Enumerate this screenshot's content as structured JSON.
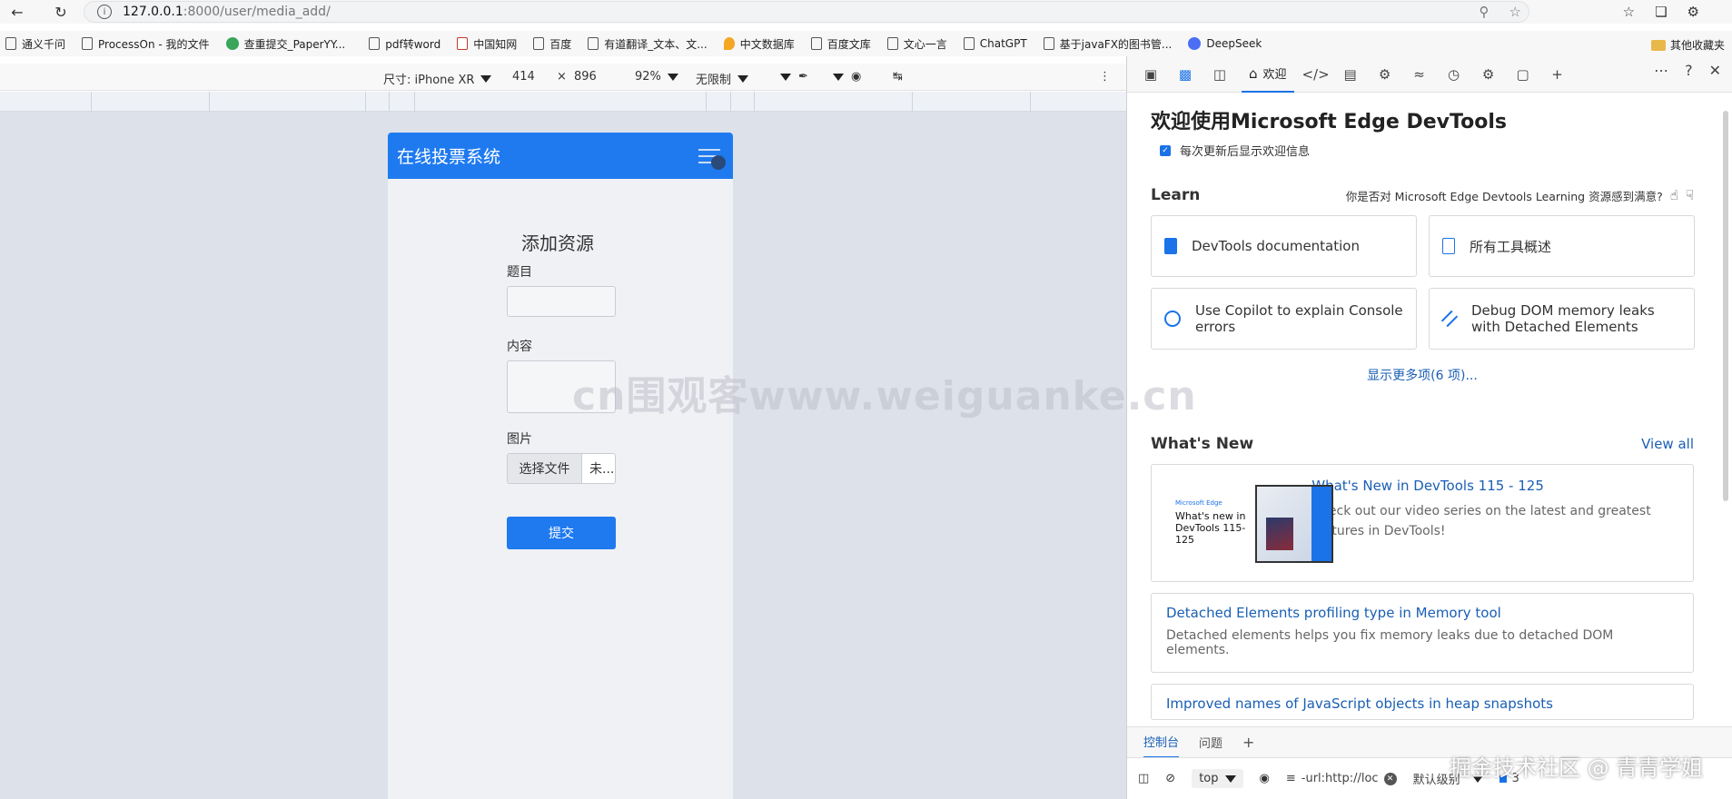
{
  "browser": {
    "url_host": "127.0.0.1",
    "url_path": ":8000/user/media_add/",
    "bookmarks": [
      "通义千问",
      "ProcessOn - 我的文件",
      "查重提交_PaperYY...",
      "pdf转word",
      "中国知网",
      "百度",
      "有道翻译_文本、文...",
      "中文数据库",
      "百度文库",
      "文心一言",
      "ChatGPT",
      "基于javaFX的图书管...",
      "DeepSeek"
    ],
    "bookmarks_folder": "其他收藏夹"
  },
  "device_toolbar": {
    "size_label": "尺寸: iPhone XR",
    "width": "414",
    "times": "×",
    "height": "896",
    "zoom": "92%",
    "throttle": "无限制"
  },
  "app": {
    "title": "在线投票系统",
    "form_title": "添加资源",
    "title_label": "题目",
    "content_label": "内容",
    "image_label": "图片",
    "file_button": "选择文件",
    "file_name": "未...",
    "submit_label": "提交"
  },
  "devtools": {
    "welcome_tab": "欢迎",
    "heading": "欢迎使用Microsoft Edge DevTools",
    "checkbox_label": "每次更新后显示欢迎信息",
    "learn_title": "Learn",
    "learn_question": "你是否对 Microsoft Edge Devtools Learning 资源感到满意?",
    "cards": [
      {
        "label": "DevTools documentation",
        "icon": "book-icon"
      },
      {
        "label": "所有工具概述",
        "icon": "document-icon"
      },
      {
        "label": "Use Copilot to explain Console errors",
        "icon": "copilot-icon"
      },
      {
        "label": "Debug DOM memory leaks with Detached Elements",
        "icon": "link-icon"
      }
    ],
    "show_more": "显示更多项(6 项)...",
    "whats_new_title": "What's New",
    "view_all": "View all",
    "news": [
      {
        "title": "What's New in DevTools 115 - 125",
        "desc": "Check out our video series on the latest and greatest features in DevTools!",
        "thumb_brand": "Microsoft Edge",
        "thumb_text": "What's new in DevTools 115-125"
      },
      {
        "title": "Detached Elements profiling type in Memory tool",
        "desc": "Detached elements helps you fix memory leaks due to detached DOM elements."
      },
      {
        "title": "Improved names of JavaScript objects in heap snapshots",
        "desc": ""
      }
    ],
    "drawer_tabs": [
      "控制台",
      "问题"
    ],
    "console_context": "top",
    "console_filter": "-url:http://loc",
    "log_level": "默认级别",
    "issues_count": "3"
  },
  "watermarks": {
    "center": "cn围观客www.weiguanke.cn",
    "corner": "掘金技术社区 @ 青青学姐"
  },
  "colors": {
    "app_blue": "#1f7af0",
    "devtools_blue": "#1a73e8",
    "link_blue": "#1a5fb4"
  }
}
